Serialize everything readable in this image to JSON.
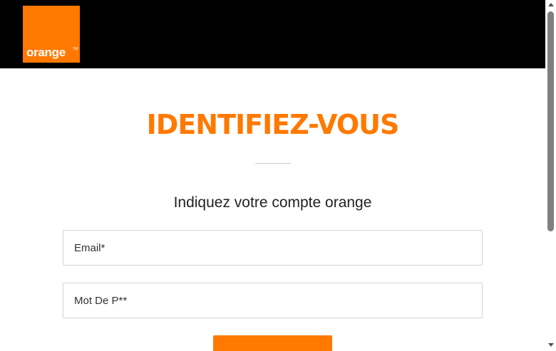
{
  "header": {
    "logo_text": "orange",
    "logo_tm": "TM"
  },
  "main": {
    "title": "IDENTIFIEZ-VOUS",
    "subtitle": "Indiquez votre compte orange",
    "email_placeholder": "Email*",
    "password_placeholder": "Mot De P**",
    "submit_label": ""
  },
  "colors": {
    "brand_orange": "#ff7900",
    "header_bg": "#000000"
  }
}
